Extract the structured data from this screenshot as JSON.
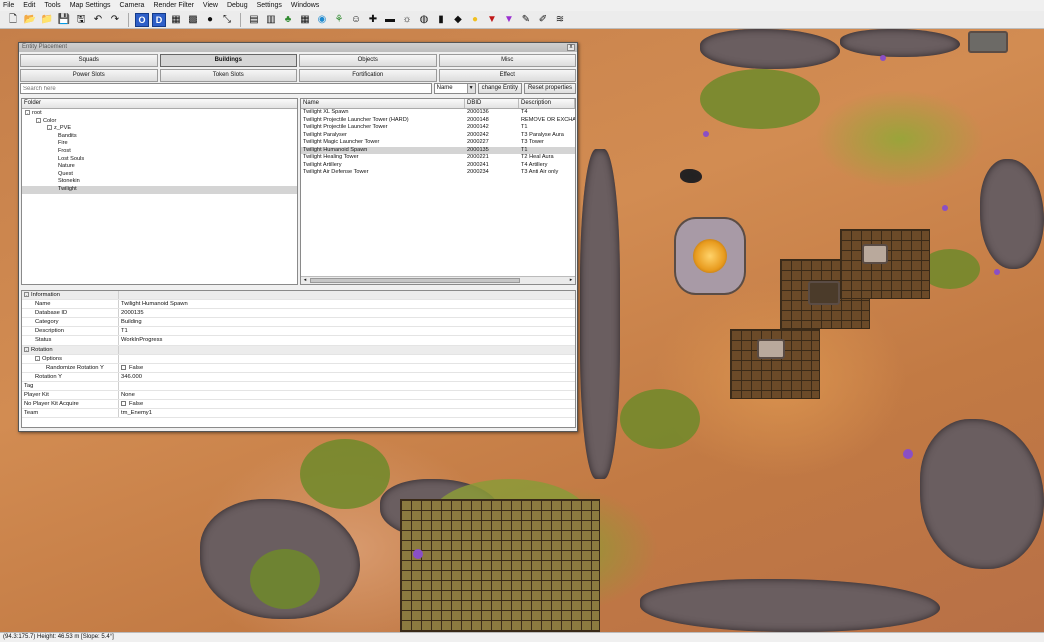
{
  "menu": [
    "File",
    "Edit",
    "Tools",
    "Map Settings",
    "Camera",
    "Render Filter",
    "View",
    "Debug",
    "Settings",
    "Windows"
  ],
  "toolbar": {
    "icons": [
      "new-file-icon",
      "open-folder-icon",
      "open-folder-alt-icon",
      "save-icon",
      "save-as-icon",
      "undo-icon",
      "redo-icon",
      "sep",
      "tool-o-icon",
      "tool-d-icon",
      "grid-a-icon",
      "grid-b-icon",
      "dot-icon",
      "scale-icon",
      "sep",
      "map-icon",
      "terrain-icon",
      "tree-icon",
      "map-grid-icon",
      "water-icon",
      "plant-icon",
      "portrait-icon",
      "cross-icon",
      "tower-icon",
      "light-icon",
      "sphere-icon",
      "pump-icon",
      "gem-icon",
      "bulb-icon",
      "marker-red-icon",
      "marker-purple-icon",
      "brush-icon",
      "pen-icon",
      "wave-icon"
    ],
    "labels": {
      "tool-o-icon": "O",
      "tool-d-icon": "D"
    }
  },
  "window": {
    "title": "Entity Placement",
    "close": "x",
    "tabs_row1": [
      "Squads",
      "Buildings",
      "Objects",
      "Misc"
    ],
    "tabs_row2": [
      "Power Slots",
      "Token Slots",
      "Fortification",
      "Effect"
    ],
    "active_tab": "Buildings",
    "search": {
      "placeholder": "Search here",
      "value": ""
    },
    "sort_select": "Name",
    "change_entity": "change Entity",
    "reset_properties": "Reset properties"
  },
  "folder": {
    "header": "Folder",
    "tree": [
      {
        "label": "root",
        "depth": 0,
        "toggle": "-"
      },
      {
        "label": "Color",
        "depth": 1,
        "toggle": "-"
      },
      {
        "label": "z_PVE",
        "depth": 2,
        "toggle": "-"
      },
      {
        "label": "Bandits",
        "depth": 3,
        "toggle": ""
      },
      {
        "label": "Fire",
        "depth": 3,
        "toggle": ""
      },
      {
        "label": "Frost",
        "depth": 3,
        "toggle": ""
      },
      {
        "label": "Lost Souls",
        "depth": 3,
        "toggle": ""
      },
      {
        "label": "Nature",
        "depth": 3,
        "toggle": ""
      },
      {
        "label": "Quest",
        "depth": 3,
        "toggle": ""
      },
      {
        "label": "Stonekin",
        "depth": 3,
        "toggle": ""
      },
      {
        "label": "Twilight",
        "depth": 3,
        "toggle": "",
        "selected": true
      }
    ]
  },
  "list": {
    "columns": [
      "Name",
      "DBID",
      "Description"
    ],
    "rows": [
      {
        "name": "Twilight XL Spawn",
        "dbid": "2000136",
        "desc": "T4"
      },
      {
        "name": "Twilight Projectile Launcher Tower (HARD)",
        "dbid": "2000148",
        "desc": "REMOVE OR EXCHA"
      },
      {
        "name": "Twilight Projectile Launcher Tower",
        "dbid": "2000142",
        "desc": "T1"
      },
      {
        "name": "Twilight Paralyser",
        "dbid": "2000242",
        "desc": "T3 Paralyse Aura"
      },
      {
        "name": "Twilight Magic Launcher Tower",
        "dbid": "2000227",
        "desc": "T3 Tower"
      },
      {
        "name": "Twilight Humanoid Spawn",
        "dbid": "2000135",
        "desc": "T1",
        "selected": true
      },
      {
        "name": "Twilight Healing Tower",
        "dbid": "2000221",
        "desc": "T2 Heal Aura"
      },
      {
        "name": "Twilight Artillery",
        "dbid": "2000241",
        "desc": "T4 Artillery"
      },
      {
        "name": "Twilight Air Defense Tower",
        "dbid": "2000234",
        "desc": "T3 Anti Air only"
      }
    ]
  },
  "properties": [
    {
      "key": "Information",
      "value": "",
      "depth": 0,
      "category": true,
      "toggle": "-"
    },
    {
      "key": "Name",
      "value": "Twilight Humanoid Spawn",
      "depth": 1
    },
    {
      "key": "Database ID",
      "value": "2000135",
      "depth": 1
    },
    {
      "key": "Category",
      "value": "Building",
      "depth": 1
    },
    {
      "key": "Description",
      "value": "T1",
      "depth": 1
    },
    {
      "key": "Status",
      "value": "WorkInProgress",
      "depth": 1
    },
    {
      "key": "Rotation",
      "value": "",
      "depth": 0,
      "category": true,
      "toggle": "-"
    },
    {
      "key": "Options",
      "value": "",
      "depth": 1,
      "toggle": "-"
    },
    {
      "key": "Randomize Rotation Y",
      "value": "False",
      "depth": 2,
      "checkbox": true
    },
    {
      "key": "Rotation Y",
      "value": "346.000",
      "depth": 1
    },
    {
      "key": "Tag",
      "value": "",
      "depth": 0
    },
    {
      "key": "Player Kit",
      "value": "None",
      "depth": 0
    },
    {
      "key": "No Player Kit Acquire",
      "value": "False",
      "depth": 0,
      "checkbox": true
    },
    {
      "key": "Team",
      "value": "tm_Enemy1",
      "depth": 0
    }
  ],
  "status": "(94.3:175.7) Height: 46.53 m [Slope: 5.4°]"
}
